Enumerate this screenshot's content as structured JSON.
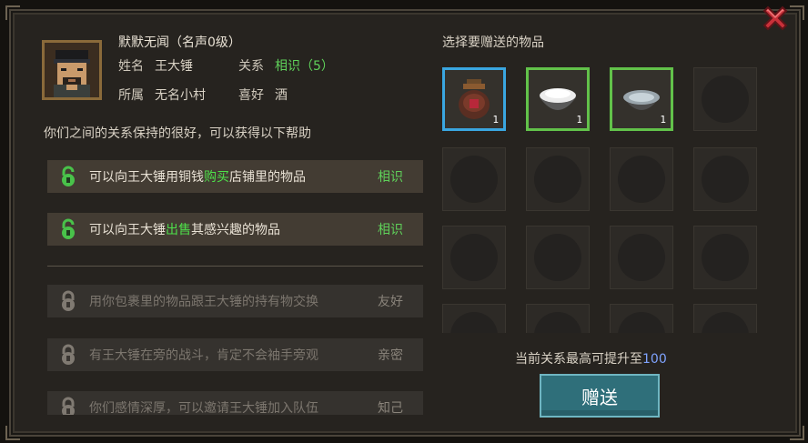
{
  "npc": {
    "title": "默默无闻（名声0级）",
    "name_label": "姓名",
    "name_value": "王大锤",
    "relation_label": "关系",
    "relation_value": "相识（5）",
    "affiliation_label": "所属",
    "affiliation_value": "无名小村",
    "hobby_label": "喜好",
    "hobby_value": "酒"
  },
  "help_text": "你们之间的关系保持的很好，可以获得以下帮助",
  "perks": [
    {
      "pre": "可以向王大锤用铜钱",
      "hl": "购买",
      "post": "店铺里的物品",
      "level": "相识",
      "state": "unlocked"
    },
    {
      "pre": "可以向王大锤",
      "hl": "出售",
      "post": "其感兴趣的物品",
      "level": "相识",
      "state": "unlocked"
    },
    {
      "pre": "用你包裹里的物品跟王大锤的持有物交换",
      "hl": "",
      "post": "",
      "level": "友好",
      "state": "locked"
    },
    {
      "pre": "有王大锤在旁的战斗，肯定不会袖手旁观",
      "hl": "",
      "post": "",
      "level": "亲密",
      "state": "locked"
    },
    {
      "pre": "你们感情深厚，可以邀请王大锤加入队伍",
      "hl": "",
      "post": "",
      "level": "知己",
      "state": "locked"
    }
  ],
  "gift": {
    "title": "选择要赠送的物品",
    "items": [
      {
        "icon": "wine-jar-icon",
        "count": "1",
        "rarity": "blue"
      },
      {
        "icon": "rice-bowl-icon",
        "count": "1",
        "rarity": "green"
      },
      {
        "icon": "water-bowl-icon",
        "count": "1",
        "rarity": "green"
      }
    ],
    "max_text": "当前关系最高可提升至",
    "max_value": "100",
    "button_label": "赠送"
  },
  "colors": {
    "panel": "#26231f",
    "highlight_green": "#4ee04a",
    "relation_green": "#5fd15a",
    "slot_blue": "#3aa6e0",
    "slot_green": "#62c24a",
    "button_teal": "#2f6f7a",
    "max_value_blue": "#7fa3ff"
  }
}
